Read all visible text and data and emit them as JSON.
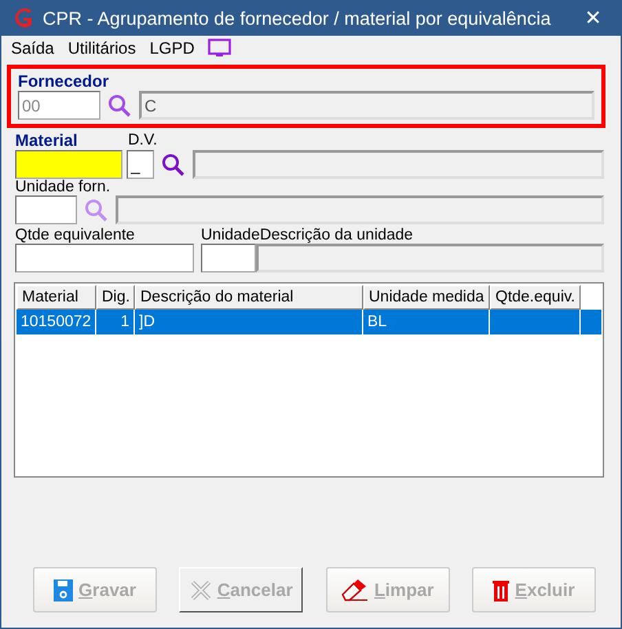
{
  "window": {
    "title": "CPR - Agrupamento de fornecedor / material por equivalência",
    "close": "✕"
  },
  "menu": [
    "Saída",
    "Utilitários",
    "LGPD"
  ],
  "fornecedor": {
    "label": "Fornecedor",
    "code": "00",
    "name": "C",
    "highlighted": true
  },
  "material": {
    "label": "Material",
    "dv_label": "D.V.",
    "dv_value": "_"
  },
  "unidade_forn": {
    "label": "Unidade forn."
  },
  "qtde": {
    "label": "Qtde equivalente",
    "unit_label": "Unidade",
    "desc_label": "Descrição da unidade"
  },
  "table": {
    "columns": [
      "Material",
      "Dig.",
      "Descrição do material",
      "Unidade medida",
      "Qtde.equiv."
    ],
    "rows": [
      {
        "cells": [
          "10150072",
          "1",
          "]D",
          "BL",
          ""
        ],
        "selected": true
      }
    ]
  },
  "buttons": [
    {
      "label": "Gravar",
      "kind": "save",
      "disabled": true
    },
    {
      "label": "Cancelar",
      "kind": "cancel",
      "disabled": true
    },
    {
      "label": "Limpar",
      "kind": "clear",
      "disabled": true
    },
    {
      "label": "Excluir",
      "kind": "delete",
      "disabled": true
    }
  ]
}
